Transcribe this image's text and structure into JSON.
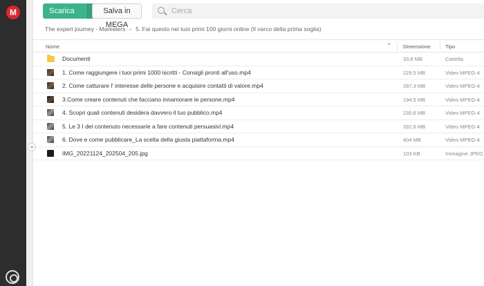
{
  "app": {
    "logo_letter": "M"
  },
  "toolbar": {
    "download_label": "Scarica",
    "dropdown_icon": "chevron-down-icon",
    "save_label": "Salva in MEGA",
    "search_placeholder": "Cerca"
  },
  "breadcrumb": {
    "items": [
      "The expert journey - Marketers",
      "5. Fai questo nei tuoi primi 100 giorni online (Il varco della prima soglia)"
    ],
    "separator": "›"
  },
  "table": {
    "columns": {
      "name": "Nome",
      "sort_indicator": "^",
      "size": "Dimensione",
      "type": "Tipo"
    },
    "rows": [
      {
        "name": "Documenti",
        "size": "33,8 MB",
        "type": "Cartella",
        "kind": "folder"
      },
      {
        "name": "1. Come raggiungere i tuoi primi 1000 iscritti - Consigli pronti all'uso.mp4",
        "size": "229,5 MB",
        "type": "Video MPEG-4",
        "kind": "video"
      },
      {
        "name": "2. Come catturare l' interesse delle persone e acquisire contatti di valore.mp4",
        "size": "287,3 MB",
        "type": "Video MPEG-4",
        "kind": "video"
      },
      {
        "name": "3.Come creare contenuti che facciano innamorare le persone.mp4",
        "size": "194,5 MB",
        "type": "Video MPEG-4",
        "kind": "video2"
      },
      {
        "name": "4. Scopri quali contenuti desidera davvero il tuo pubblico.mp4",
        "size": "235,6 MB",
        "type": "Video MPEG-4",
        "kind": "gray"
      },
      {
        "name": "5. Le 3 I del contenuto necessarie a fare contenuti persuasivi.mp4",
        "size": "332,6 MB",
        "type": "Video MPEG-4",
        "kind": "gray"
      },
      {
        "name": "6. Dove e come pubblicare_La scelta della giusta piattaforma.mp4",
        "size": "404 MB",
        "type": "Video MPEG-4",
        "kind": "gray"
      },
      {
        "name": "IMG_20221124_202504_205.jpg",
        "size": "103 KB",
        "type": "Immagine JPEG",
        "kind": "image"
      }
    ]
  },
  "colors": {
    "accent": "#3cb389",
    "logo": "#d9272e",
    "rail": "#2d2d2d"
  }
}
